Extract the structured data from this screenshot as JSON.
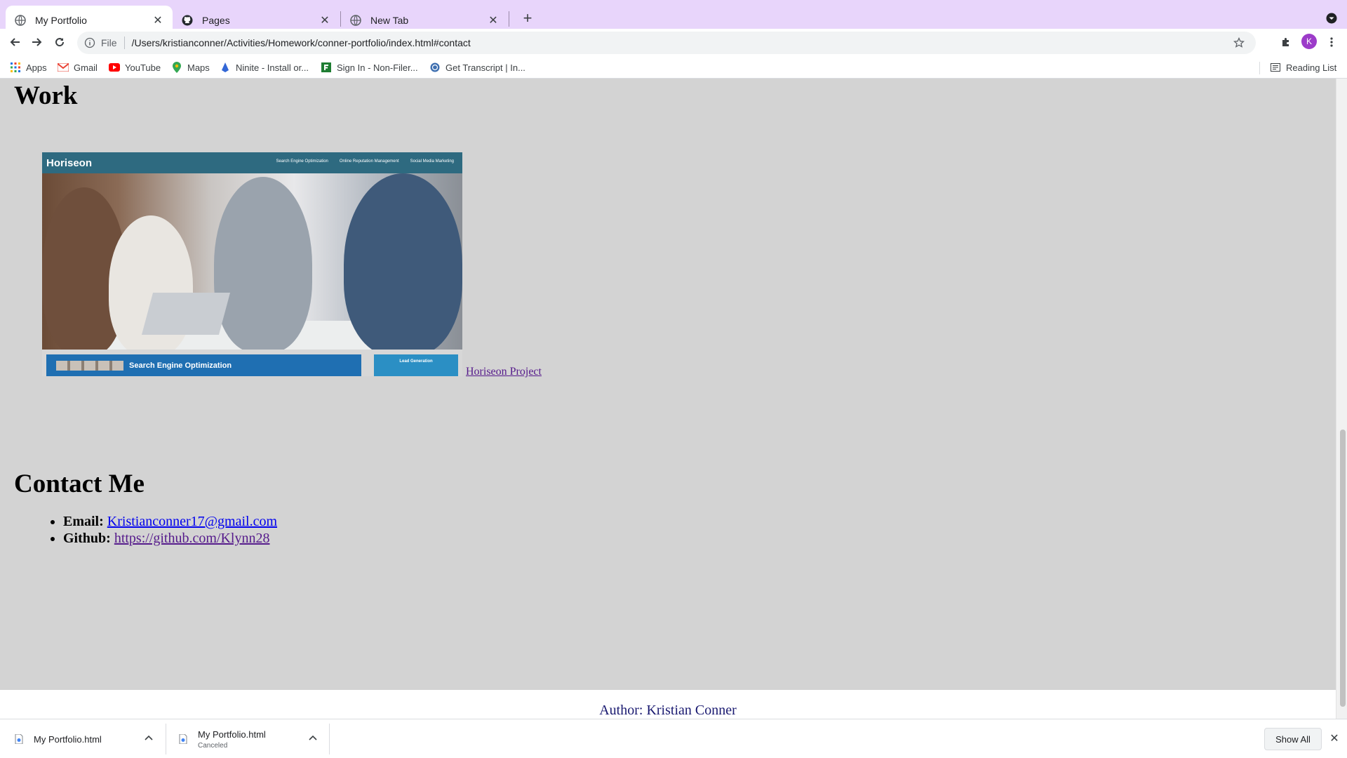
{
  "browser": {
    "tabs": [
      {
        "title": "My Portfolio",
        "icon": "globe-icon",
        "active": true
      },
      {
        "title": "Pages",
        "icon": "github-icon",
        "active": false
      },
      {
        "title": "New Tab",
        "icon": "globe-icon",
        "active": false
      }
    ],
    "omnibox": {
      "scheme_label": "File",
      "url": "/Users/kristianconner/Activities/Homework/conner-portfolio/index.html#contact"
    },
    "profile_initial": "K",
    "bookmarks": [
      {
        "label": "Apps",
        "icon": "apps-grid-icon"
      },
      {
        "label": "Gmail",
        "icon": "gmail-icon"
      },
      {
        "label": "YouTube",
        "icon": "youtube-icon"
      },
      {
        "label": "Maps",
        "icon": "maps-icon"
      },
      {
        "label": "Ninite - Install or...",
        "icon": "ninite-icon"
      },
      {
        "label": "Sign In - Non-Filer...",
        "icon": "irs-icon"
      },
      {
        "label": "Get Transcript | In...",
        "icon": "irs-seal-icon"
      }
    ],
    "reading_list": "Reading List"
  },
  "page": {
    "work_heading": "Work",
    "project": {
      "screenshot": {
        "brand": "Horiseon",
        "nav": [
          "Search Engine Optimization",
          "Online Reputation Management",
          "Social Media Marketing"
        ],
        "card1": "Search Engine Optimization",
        "card2": "Lead Generation"
      },
      "link_text": "Horiseon Project"
    },
    "contact_heading": "Contact Me",
    "contacts": [
      {
        "label": "Email:",
        "value": "Kristianconner17@gmail.com"
      },
      {
        "label": "Github:",
        "value": "https://github.com/Klynn28"
      }
    ],
    "footer": "Author: Kristian Conner"
  },
  "downloads": {
    "items": [
      {
        "filename": "My Portfolio.html",
        "status": ""
      },
      {
        "filename": "My Portfolio.html",
        "status": "Canceled"
      }
    ],
    "show_all": "Show All"
  },
  "colors": {
    "tabstrip": "#e8d5fb",
    "page_background": "#d3d3d3",
    "link": "#0000ee",
    "visited_link": "#551a8b",
    "footer_text": "#191970",
    "avatar": "#9c3bc9"
  }
}
